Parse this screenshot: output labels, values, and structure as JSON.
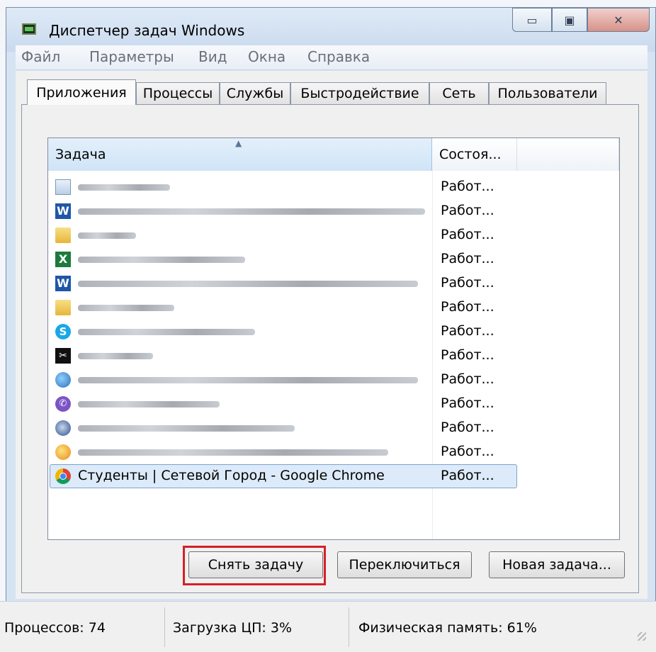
{
  "window": {
    "title": "Диспетчер задач Windows"
  },
  "controls": {
    "minimize": "▭",
    "maximize": "▣",
    "close": "✕"
  },
  "menu": [
    "Файл",
    "Параметры",
    "Вид",
    "Окна",
    "Справка"
  ],
  "tabs": [
    "Приложения",
    "Процессы",
    "Службы",
    "Быстродействие",
    "Сеть",
    "Пользователи"
  ],
  "active_tab": "Приложения",
  "table": {
    "columns": [
      "Задача",
      "Состоя..."
    ],
    "rows": [
      {
        "icon": "notepad-icon",
        "name": "",
        "status": "Работ..."
      },
      {
        "icon": "word-icon",
        "name": "",
        "status": "Работ..."
      },
      {
        "icon": "folder-icon",
        "name": "",
        "status": "Работ..."
      },
      {
        "icon": "excel-icon",
        "name": "",
        "status": "Работ..."
      },
      {
        "icon": "word-icon",
        "name": "",
        "status": "Работ..."
      },
      {
        "icon": "folder-icon",
        "name": "",
        "status": "Работ..."
      },
      {
        "icon": "skype-icon",
        "name": "",
        "status": "Работ..."
      },
      {
        "icon": "scissors-icon",
        "name": "",
        "status": "Работ..."
      },
      {
        "icon": "globe-icon",
        "name": "",
        "status": "Работ..."
      },
      {
        "icon": "viber-icon",
        "name": "",
        "status": "Работ..."
      },
      {
        "icon": "thunderbird-icon",
        "name": "",
        "status": "Работ..."
      },
      {
        "icon": "paint-icon",
        "name": "",
        "status": "Работ..."
      },
      {
        "icon": "chrome-icon",
        "name": "Студенты | Сетевой Город - Google Chrome",
        "status": "Работ...",
        "selected": true
      }
    ]
  },
  "buttons": {
    "end_task": "Снять задачу",
    "switch_to": "Переключиться",
    "new_task": "Новая задача..."
  },
  "statusbar": {
    "processes": "Процессов: 74",
    "cpu": "Загрузка ЦП: 3%",
    "memory": "Физическая память: 61%"
  },
  "colors": {
    "highlight": "#d42027",
    "selection": "#dceaf9"
  }
}
